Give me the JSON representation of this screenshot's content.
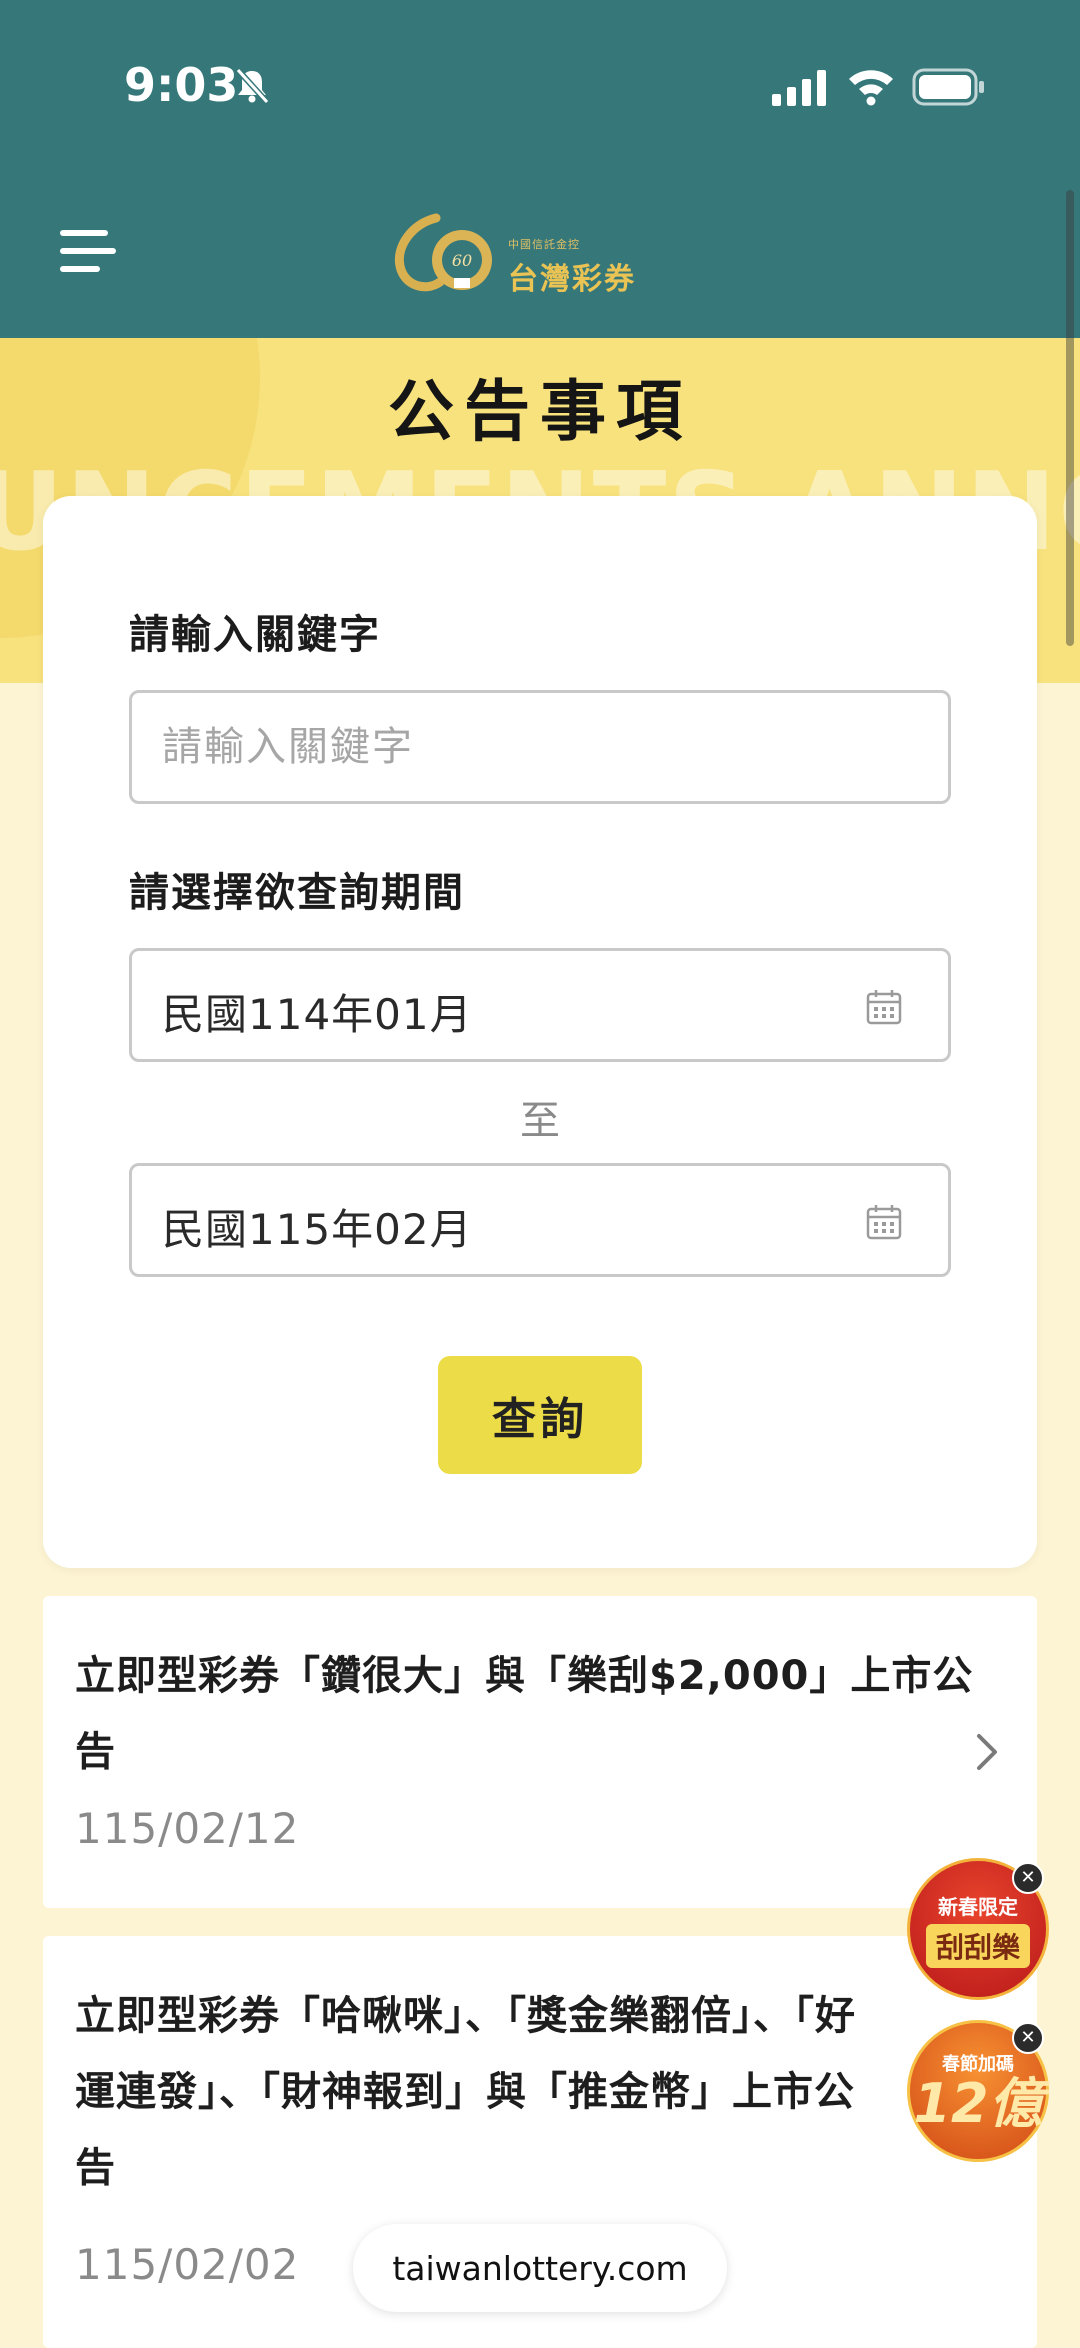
{
  "status": {
    "time": "9:03"
  },
  "header": {
    "logo_small": "中國信託金控",
    "logo_big": "台灣彩券"
  },
  "banner": {
    "title": "公告事項",
    "bg_word": "UNCEMENTS ANNOUNCE"
  },
  "search": {
    "keyword_label": "請輸入關鍵字",
    "keyword_placeholder": "請輸入關鍵字",
    "period_label": "請選擇欲查詢期間",
    "start_date": "民國114年01月",
    "to_label": "至",
    "end_date": "民國115年02月",
    "submit_label": "查詢"
  },
  "announcements": [
    {
      "title": "立即型彩券「鑽很大」與「樂刮$2,000」上市公告",
      "date": "115/02/12"
    },
    {
      "title": "立即型彩券「哈啾咪」、「獎金樂翻倍」、「好運連發」、「財神報到」與「推金幣」上市公告",
      "date": "115/02/02"
    }
  ],
  "floating": {
    "badge1_top": "新春限定",
    "badge1_bottom": "刮刮樂",
    "badge2_top": "春節加碼",
    "badge2_bottom": "12億"
  },
  "browser": {
    "url": "taiwanlottery.com"
  },
  "colors": {
    "header": "#36777a",
    "banner": "#f8e27e",
    "button": "#ecdc47",
    "background": "#fdf4d3"
  }
}
